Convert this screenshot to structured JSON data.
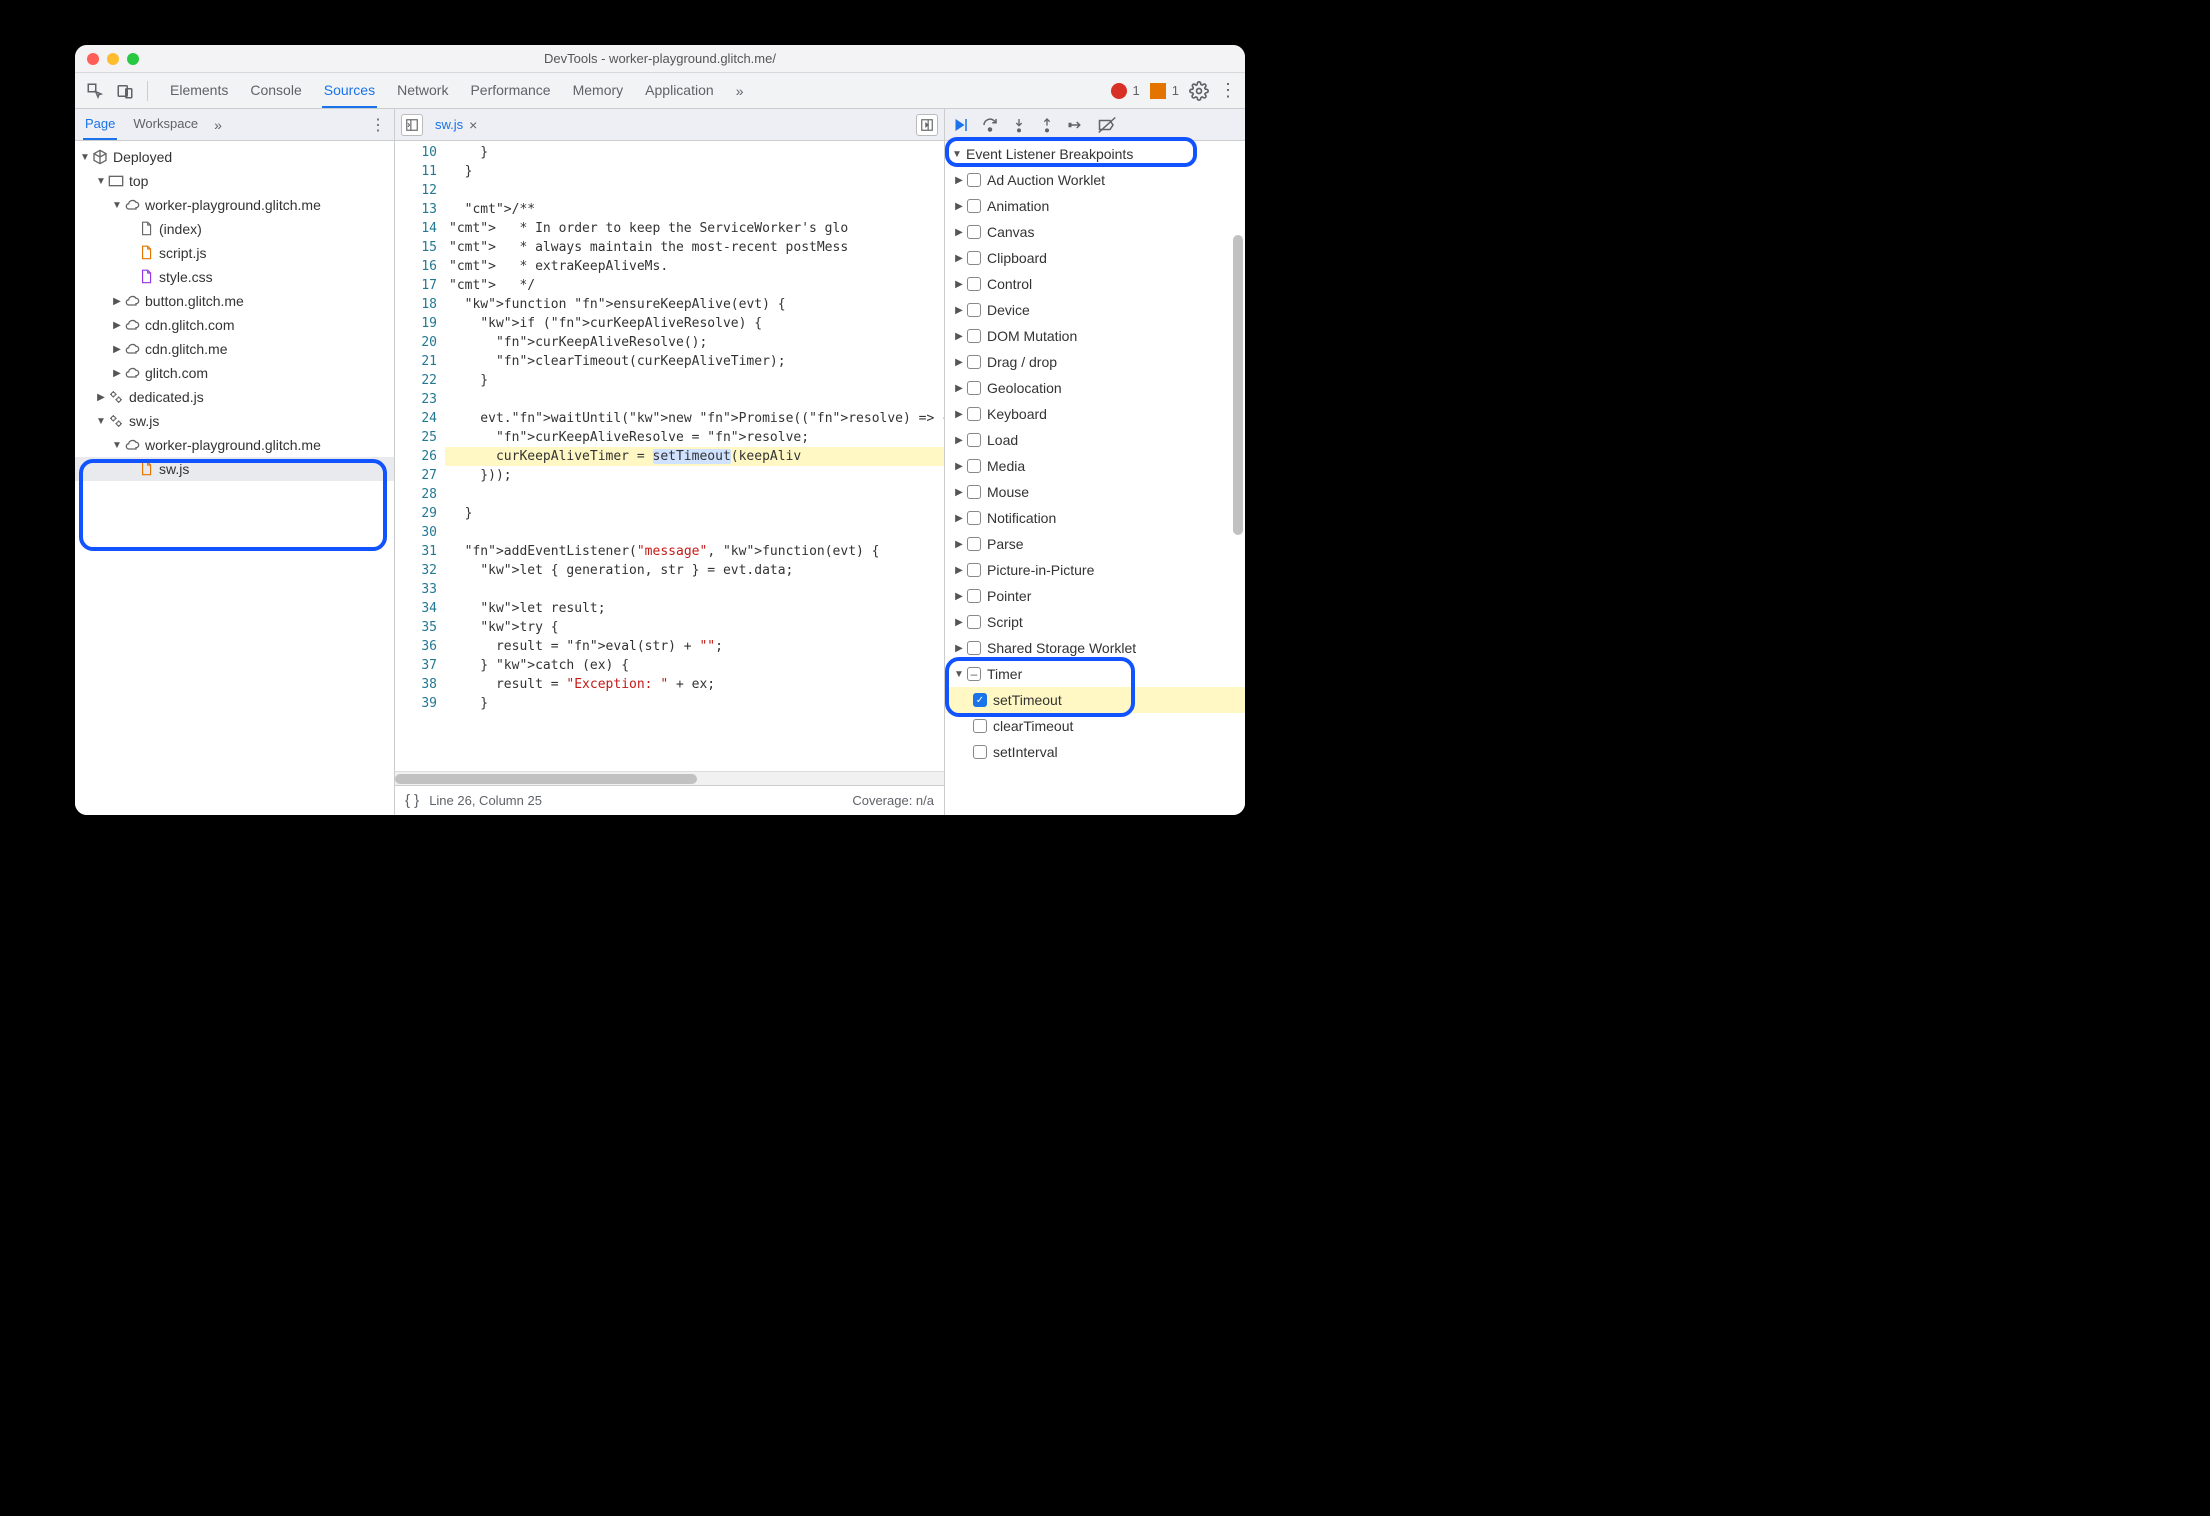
{
  "window_title": "DevTools - worker-playground.glitch.me/",
  "main_tabs": [
    "Elements",
    "Console",
    "Sources",
    "Network",
    "Performance",
    "Memory",
    "Application"
  ],
  "main_tabs_active": "Sources",
  "errors_count": "1",
  "warnings_count": "1",
  "left": {
    "tabs": [
      "Page",
      "Workspace"
    ],
    "active": "Page",
    "tree": {
      "root": "Deployed",
      "top": "top",
      "origin1": "worker-playground.glitch.me",
      "files1": [
        "(index)",
        "script.js",
        "style.css"
      ],
      "origins_collapsed": [
        "button.glitch.me",
        "cdn.glitch.com",
        "cdn.glitch.me",
        "glitch.com"
      ],
      "dedicated": "dedicated.js",
      "sw_root": "sw.js",
      "sw_origin": "worker-playground.glitch.me",
      "sw_file": "sw.js"
    }
  },
  "editor": {
    "tab": "sw.js",
    "first_line": 10,
    "lines": [
      "    }",
      "  }",
      "",
      "  /**",
      "   * In order to keep the ServiceWorker's glo",
      "   * always maintain the most-recent postMess",
      "   * extraKeepAliveMs.",
      "   */",
      "  function ensureKeepAlive(evt) {",
      "    if (curKeepAliveResolve) {",
      "      curKeepAliveResolve();",
      "      clearTimeout(curKeepAliveTimer);",
      "    }",
      "",
      "    evt.waitUntil(new Promise((resolve) => {",
      "      curKeepAliveResolve = resolve;",
      "      curKeepAliveTimer = setTimeout(keepAliv",
      "    }));",
      "",
      "  }",
      "",
      "  addEventListener(\"message\", function(evt) {",
      "    let { generation, str } = evt.data;",
      "",
      "    let result;",
      "    try {",
      "      result = eval(str) + \"\";",
      "    } catch (ex) {",
      "      result = \"Exception: \" + ex;",
      "    }"
    ],
    "highlight_line": 26,
    "highlight_word": "setTimeout"
  },
  "status": {
    "cursor": "Line 26, Column 25",
    "coverage": "Coverage: n/a"
  },
  "breakpoints": {
    "section": "Event Listener Breakpoints",
    "categories": [
      "Ad Auction Worklet",
      "Animation",
      "Canvas",
      "Clipboard",
      "Control",
      "Device",
      "DOM Mutation",
      "Drag / drop",
      "Geolocation",
      "Keyboard",
      "Load",
      "Media",
      "Mouse",
      "Notification",
      "Parse",
      "Picture-in-Picture",
      "Pointer",
      "Script",
      "Shared Storage Worklet"
    ],
    "timer": {
      "label": "Timer",
      "children": [
        {
          "label": "setTimeout",
          "checked": true
        },
        {
          "label": "clearTimeout",
          "checked": false
        },
        {
          "label": "setInterval",
          "checked": false
        }
      ]
    }
  }
}
